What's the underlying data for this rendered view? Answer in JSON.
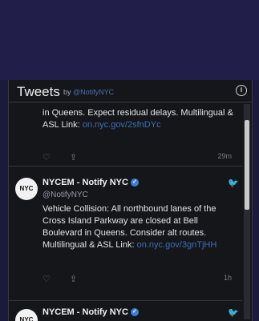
{
  "header": {
    "title": "Tweets",
    "by_label": "by",
    "handle": "@NotifyNYC",
    "info_glyph": "i"
  },
  "tweets": [
    {
      "text": "in Queens. Expect residual delays. Multilingual & ASL Link: ",
      "link": "on.nyc.gov/2sfnDYc",
      "time": "29m",
      "heart_icon": "heart-icon",
      "share_icon": "share-icon"
    },
    {
      "avatar_label": "NYC",
      "name": "NYCEM - Notify NYC",
      "verified_glyph": "✓",
      "handle": "@NotifyNYC",
      "text": "Vehicle Collision: All northbound lanes of the Cross Island Parkway are closed at Bell Boulevard in Queens. Consider alt routes. Multilingual & ASL Link: ",
      "link": "on.nyc.gov/3gnTjHH",
      "time": "1h",
      "heart_icon": "heart-icon",
      "share_icon": "share-icon"
    },
    {
      "avatar_label": "NYC",
      "name": "NYCEM - Notify NYC",
      "verified_glyph": "✓"
    }
  ],
  "colors": {
    "background_band": "#211f4a",
    "widget_bg": "#15161a",
    "link": "#3d6fb6",
    "verified": "#3b7fd6"
  }
}
